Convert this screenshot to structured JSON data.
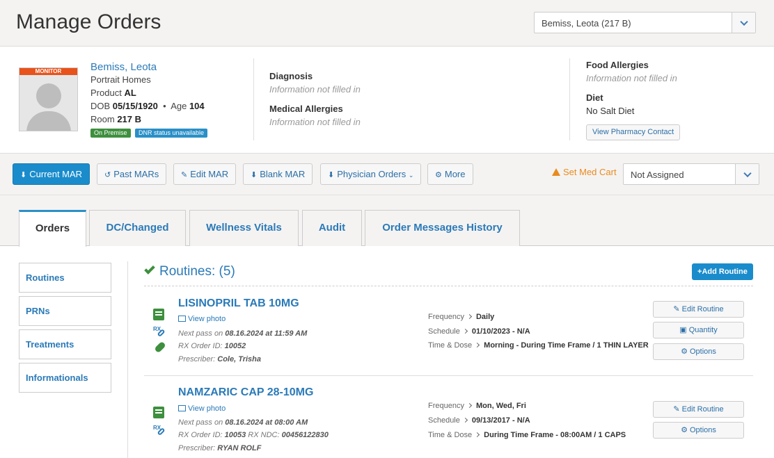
{
  "header": {
    "title": "Manage Orders",
    "resident_select": "Bemiss, Leota (217 B)"
  },
  "patient": {
    "monitor_badge": "MONITOR",
    "name": "Bemiss, Leota",
    "facility": "Portrait Homes",
    "product_label": "Product",
    "product": "AL",
    "dob_label": "DOB",
    "dob": "05/15/1920",
    "age_label": "Age",
    "age": "104",
    "room_label": "Room",
    "room": "217 B",
    "tag_on_premise": "On Premise",
    "tag_dnr": "DNR status unavailable",
    "diagnosis_label": "Diagnosis",
    "diagnosis_value": "Information not filled in",
    "med_allergies_label": "Medical Allergies",
    "med_allergies_value": "Information not filled in",
    "food_allergies_label": "Food Allergies",
    "food_allergies_value": "Information not filled in",
    "diet_label": "Diet",
    "diet_value": "No Salt Diet",
    "pharmacy_button": "View Pharmacy Contact"
  },
  "toolbar": {
    "current_mar": "Current MAR",
    "past_mars": "Past MARs",
    "edit_mar": "Edit MAR",
    "blank_mar": "Blank MAR",
    "physician_orders": "Physician Orders",
    "more": "More",
    "set_med_cart": "Set Med Cart",
    "cart_select": "Not Assigned"
  },
  "tabs": [
    "Orders",
    "DC/Changed",
    "Wellness Vitals",
    "Audit",
    "Order Messages History"
  ],
  "sidebar": [
    "Routines",
    "PRNs",
    "Treatments",
    "Informationals"
  ],
  "routines": {
    "title": "Routines: (5)",
    "add_button": "Add Routine",
    "orders": [
      {
        "name": "LISINOPRIL TAB 10MG",
        "view_photo": "View photo",
        "next_pass_label": "Next pass on",
        "next_pass": "08.16.2024 at 11:59 AM",
        "rx_label": "RX Order ID:",
        "rx_id": "10052",
        "ndc_label": "",
        "ndc": "",
        "prescriber_label": "Prescriber:",
        "prescriber": "Cole, Trisha",
        "frequency_label": "Frequency",
        "frequency": "Daily",
        "schedule_label": "Schedule",
        "schedule": "01/10/2023 - N/A",
        "time_dose_label": "Time & Dose",
        "time_dose": "Morning - During Time Frame / 1 THIN LAYER",
        "btn_edit": "Edit Routine",
        "btn_quantity": "Quantity",
        "btn_options": "Options"
      },
      {
        "name": "NAMZARIC CAP 28-10MG",
        "view_photo": "View photo",
        "next_pass_label": "Next pass on",
        "next_pass": "08.16.2024 at 08:00 AM",
        "rx_label": "RX Order ID:",
        "rx_id": "10053",
        "ndc_label": "RX NDC:",
        "ndc": "00456122830",
        "prescriber_label": "Prescriber:",
        "prescriber": "RYAN ROLF",
        "frequency_label": "Frequency",
        "frequency": "Mon, Wed, Fri",
        "schedule_label": "Schedule",
        "schedule": "09/13/2017 - N/A",
        "time_dose_label": "Time & Dose",
        "time_dose": "During Time Frame - 08:00AM / 1 CAPS",
        "btn_edit": "Edit Routine",
        "btn_options": "Options"
      }
    ]
  },
  "colors": {
    "accent": "#1a8ccc",
    "link": "#2a7ab8",
    "success": "#3e8f3e",
    "warning": "#e88b1f",
    "monitor": "#e8521b"
  }
}
